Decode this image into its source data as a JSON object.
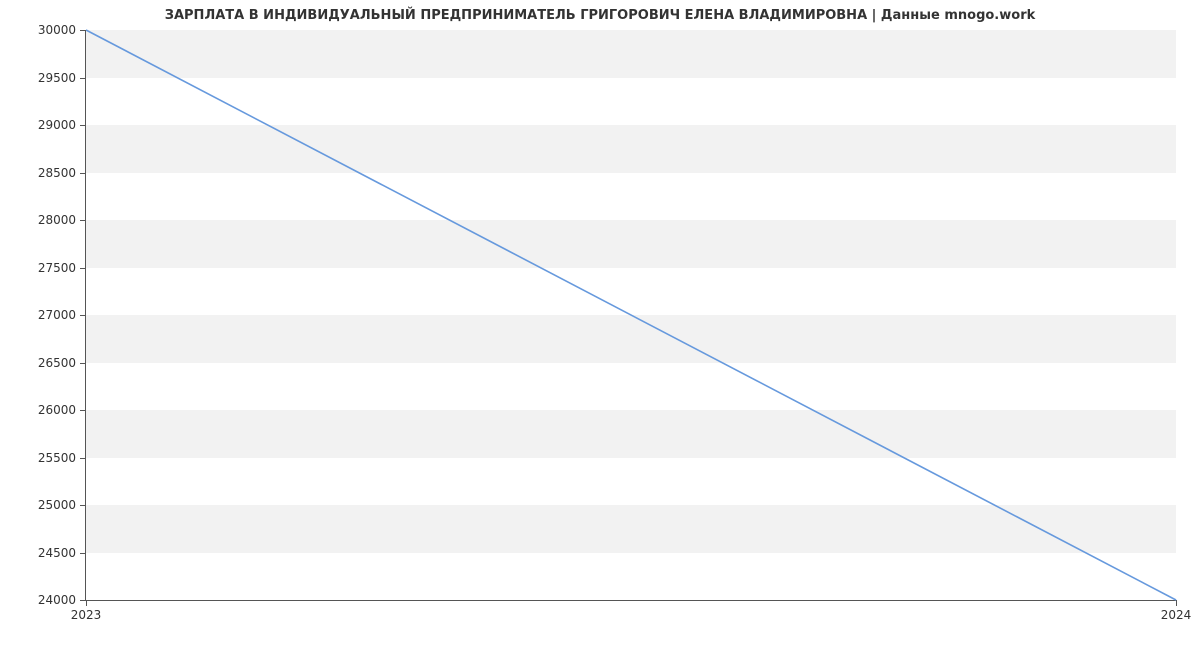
{
  "chart_data": {
    "type": "line",
    "title": "ЗАРПЛАТА В ИНДИВИДУАЛЬНЫЙ ПРЕДПРИНИМАТЕЛЬ ГРИГОРОВИЧ ЕЛЕНА ВЛАДИМИРОВНА | Данные mnogo.work",
    "x": [
      2023,
      2024
    ],
    "values": [
      30000,
      24000
    ],
    "x_ticks": [
      2023,
      2024
    ],
    "y_ticks": [
      24000,
      24500,
      25000,
      25500,
      26000,
      26500,
      27000,
      27500,
      28000,
      28500,
      29000,
      29500,
      30000
    ],
    "xlim": [
      2023,
      2024
    ],
    "ylim": [
      24000,
      30000
    ],
    "line_color": "#6699dd",
    "band_color": "#f2f2f2"
  }
}
